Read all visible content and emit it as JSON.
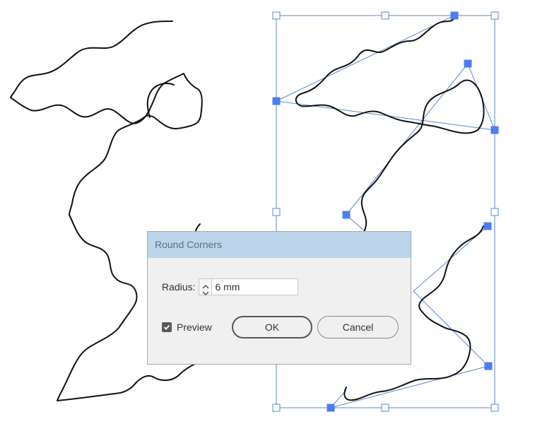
{
  "dialog": {
    "title": "Round Corners",
    "radius_label": "Radius:",
    "radius_value": "6 mm",
    "preview_label": "Preview",
    "preview_checked": true,
    "ok_label": "OK",
    "cancel_label": "Cancel"
  },
  "colors": {
    "selection": "#5b87d6",
    "handle": "#4e7cf2",
    "title_bar": "#bdd5ea",
    "dialog_bg": "#f0f0f0",
    "stroke": "#111111"
  }
}
